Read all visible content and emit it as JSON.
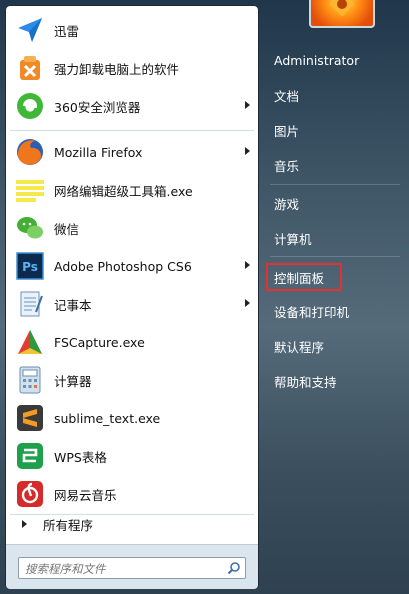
{
  "programs": [
    {
      "label": "迅雷",
      "icon": "xunlei-icon",
      "arrow": false
    },
    {
      "label": "强力卸载电脑上的软件",
      "icon": "uninstall-icon",
      "arrow": false
    },
    {
      "label": "360安全浏览器",
      "icon": "360-browser-icon",
      "arrow": true
    },
    {
      "label": "Mozilla Firefox",
      "icon": "firefox-icon",
      "arrow": true
    },
    {
      "label": "网络编辑超级工具箱.exe",
      "icon": "toolbox-icon",
      "arrow": false
    },
    {
      "label": "微信",
      "icon": "wechat-icon",
      "arrow": false
    },
    {
      "label": "Adobe Photoshop CS6",
      "icon": "photoshop-icon",
      "arrow": true
    },
    {
      "label": "记事本",
      "icon": "notepad-icon",
      "arrow": true
    },
    {
      "label": "FSCapture.exe",
      "icon": "fscapture-icon",
      "arrow": false
    },
    {
      "label": "计算器",
      "icon": "calculator-icon",
      "arrow": false
    },
    {
      "label": "sublime_text.exe",
      "icon": "sublime-icon",
      "arrow": false
    },
    {
      "label": "WPS表格",
      "icon": "wps-sheet-icon",
      "arrow": false
    },
    {
      "label": "网易云音乐",
      "icon": "netease-music-icon",
      "arrow": false
    }
  ],
  "all_programs_label": "所有程序",
  "search": {
    "placeholder": "搜索程序和文件"
  },
  "right_items": [
    {
      "label": "Administrator"
    },
    {
      "label": "文档"
    },
    {
      "label": "图片"
    },
    {
      "label": "音乐"
    },
    {
      "label": "游戏"
    },
    {
      "label": "计算机"
    },
    {
      "label": "控制面板",
      "highlighted": true
    },
    {
      "label": "设备和打印机"
    },
    {
      "label": "默认程序"
    },
    {
      "label": "帮助和支持"
    }
  ],
  "colors": {
    "highlight_border": "#e53030",
    "accent": "#2b5797"
  }
}
